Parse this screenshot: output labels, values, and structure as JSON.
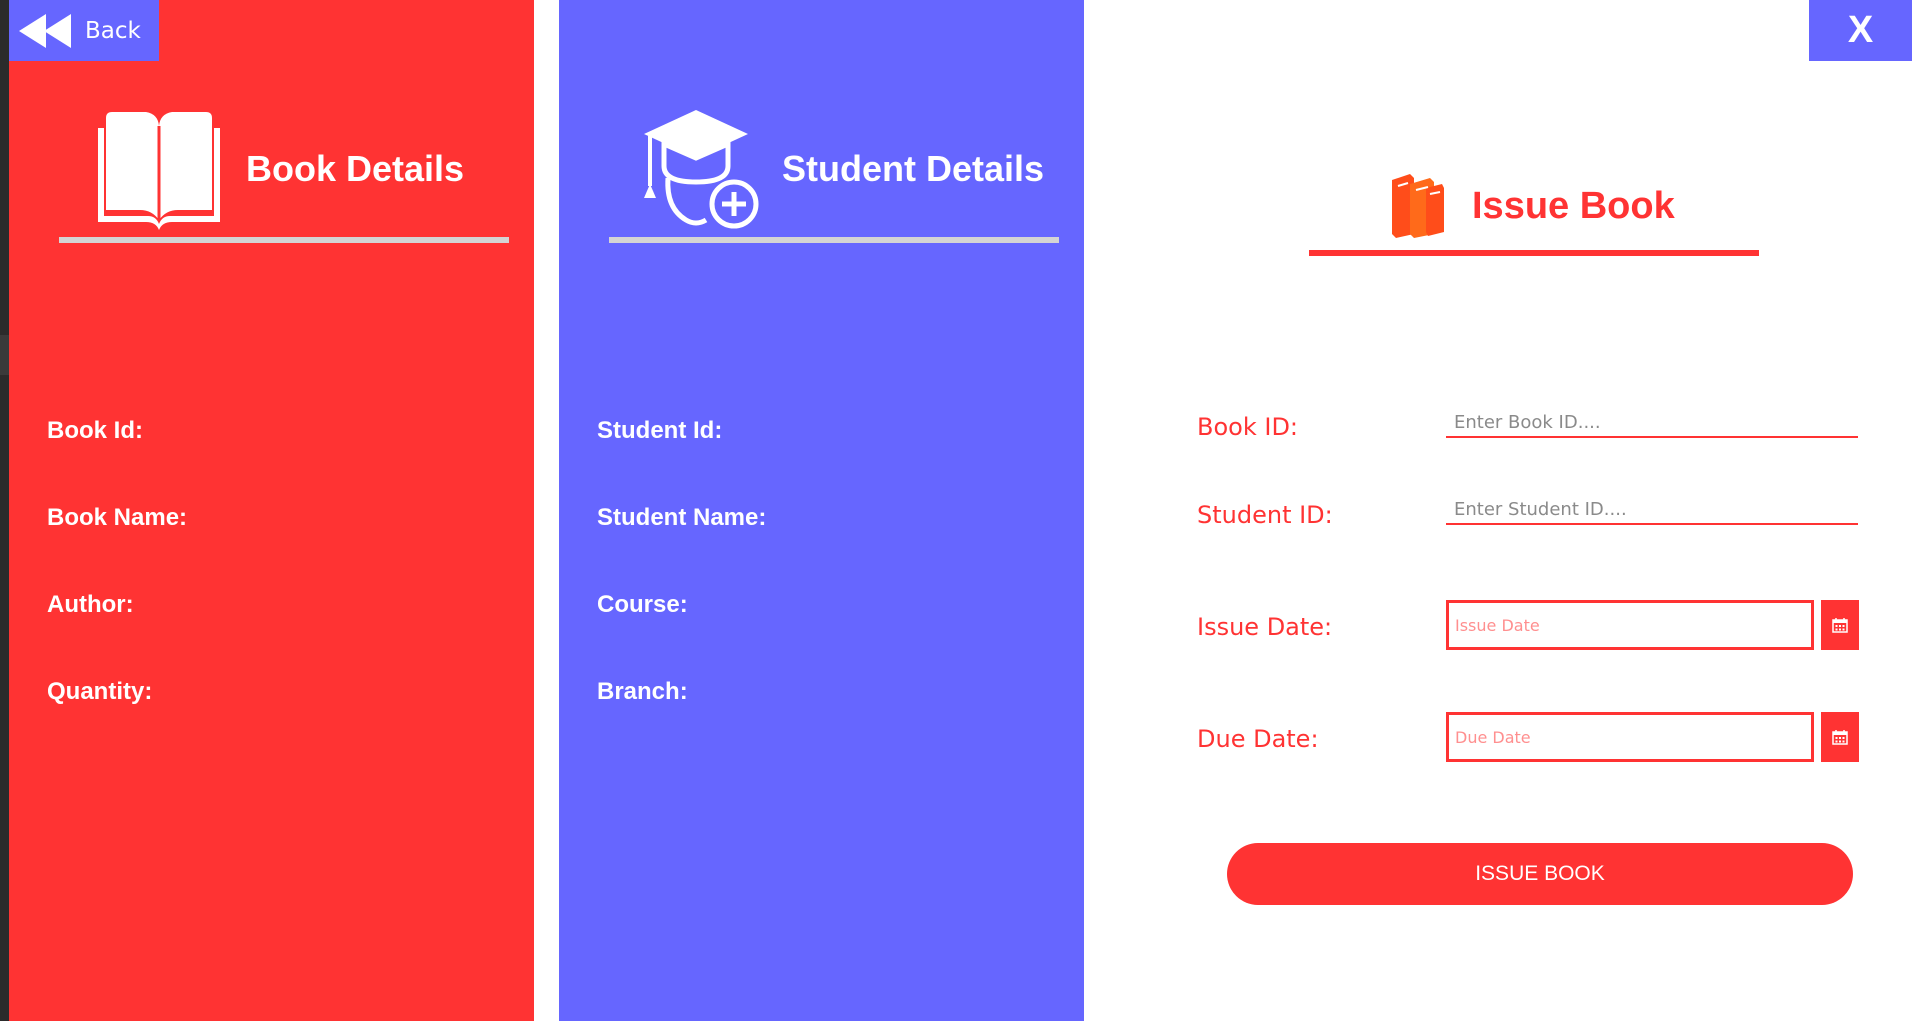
{
  "colors": {
    "red": "#ff3333",
    "blue": "#6666ff",
    "white": "#ffffff",
    "divider_gray": "#d4d4d4",
    "book_icon_orange": "#ff4d1a"
  },
  "nav": {
    "back_label": "Back",
    "back_icon": "rewind-icon",
    "close_label": "X"
  },
  "book_details": {
    "icon": "open-book-icon",
    "title": "Book Details",
    "fields": {
      "book_id": "Book Id:",
      "book_name": "Book Name:",
      "author": "Author:",
      "quantity": "Quantity:"
    }
  },
  "student_details": {
    "icon": "graduate-add-icon",
    "title": "Student Details",
    "fields": {
      "student_id": "Student Id:",
      "student_name": "Student Name:",
      "course": "Course:",
      "branch": "Branch:"
    }
  },
  "issue_book": {
    "icon": "books-icon",
    "title": "Issue Book",
    "book_id_label": "Book ID:",
    "book_id_placeholder": "Enter Book ID....",
    "book_id_value": "",
    "student_id_label": "Student ID:",
    "student_id_placeholder": "Enter Student ID....",
    "student_id_value": "",
    "issue_date_label": "Issue Date:",
    "issue_date_placeholder": "Issue Date",
    "due_date_label": "Due Date:",
    "due_date_placeholder": "Due Date",
    "calendar_icon": "calendar-icon",
    "submit_label": "ISSUE BOOK"
  }
}
